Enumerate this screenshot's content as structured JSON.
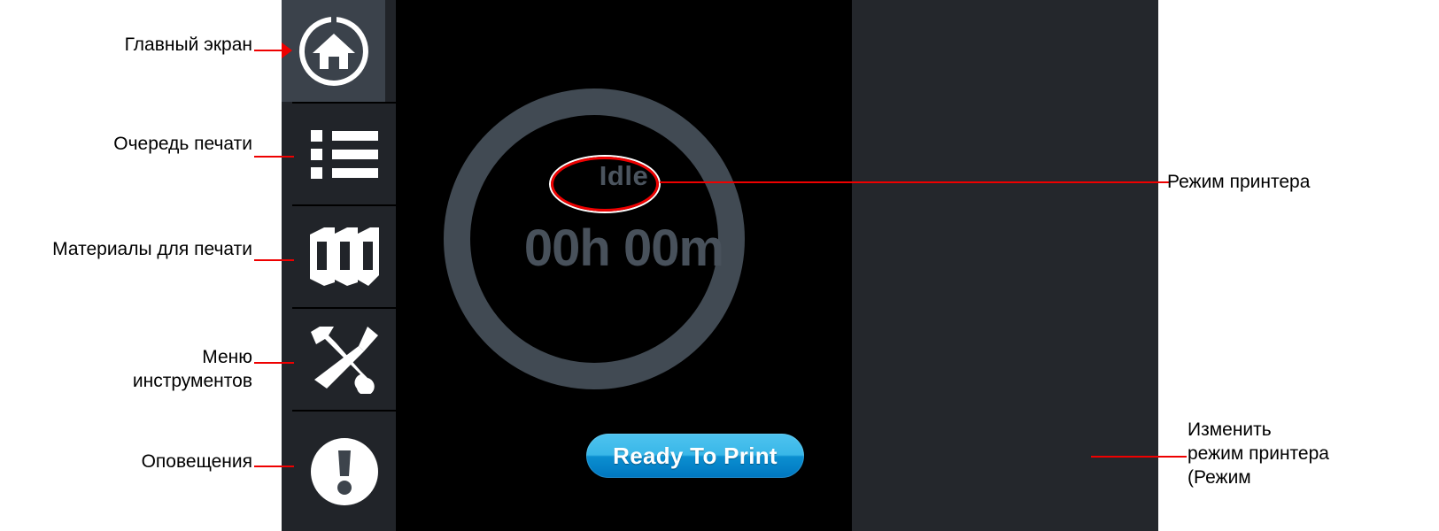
{
  "screen": {
    "sidebar": {
      "items": [
        {
          "id": "home",
          "icon": "home-icon",
          "active": true,
          "annotation": "Главный экран"
        },
        {
          "id": "print-queue",
          "icon": "list-icon",
          "active": false,
          "annotation": "Очередь печати"
        },
        {
          "id": "materials",
          "icon": "material-spool-icon",
          "active": false,
          "annotation": "Материалы для печати"
        },
        {
          "id": "tools",
          "icon": "tools-icon",
          "active": false,
          "annotation": "Меню\nинструментов"
        },
        {
          "id": "alerts",
          "icon": "alert-exclamation-icon",
          "active": false,
          "annotation": "Оповещения"
        }
      ]
    },
    "status_dial": {
      "mode": "Idle",
      "time_remaining": "00h 00m"
    },
    "actions": {
      "ready_to_print": "Ready To Print"
    }
  },
  "annotations": {
    "printer_mode": "Режим принтера",
    "change_printer_mode": "Изменить\nрежим принтера\n(Режим"
  },
  "colors": {
    "screen_black": "#000000",
    "sidebar": "#212429",
    "sidebar_active": "#3b424b",
    "right_panel": "#24272c",
    "ring": "#414a53",
    "dial_text": "#48515b",
    "button_blue_top": "#4ec3ef",
    "button_blue_bottom": "#0077c0",
    "annotation_red": "#ee0000"
  }
}
